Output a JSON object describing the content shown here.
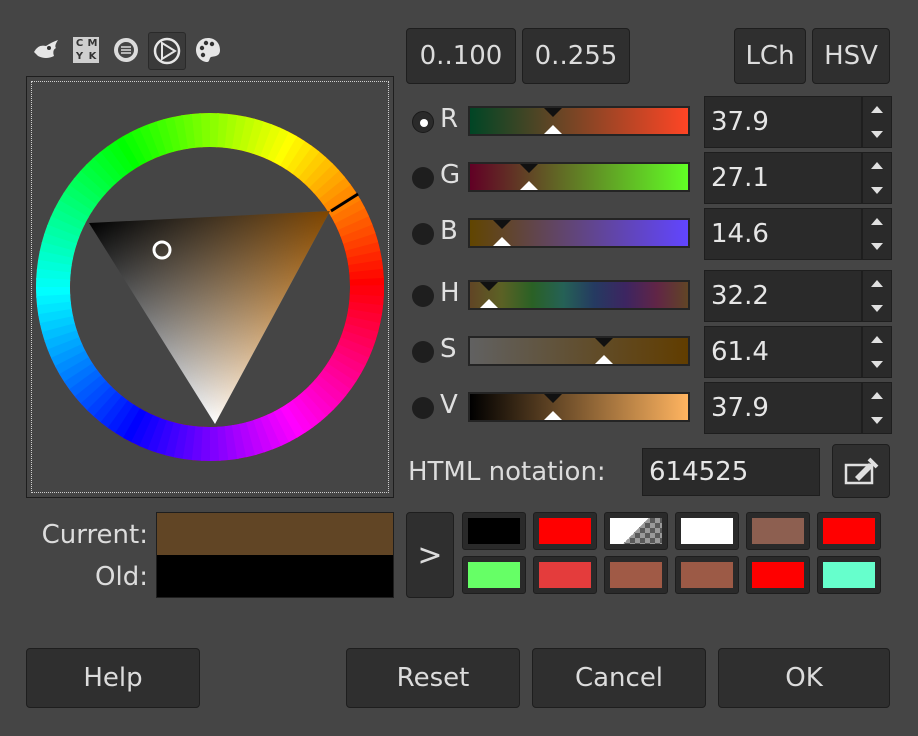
{
  "selector_tabs": [
    {
      "name": "gimp-icon"
    },
    {
      "name": "cmyk-icon",
      "label": "CMYK"
    },
    {
      "name": "watercolor-icon"
    },
    {
      "name": "triangle-wheel-icon",
      "active": true
    },
    {
      "name": "palette-icon"
    }
  ],
  "range_buttons": {
    "percent": "0..100",
    "byte": "0..255"
  },
  "model_buttons": {
    "lch": "LCh",
    "hsv": "HSV"
  },
  "channels": [
    {
      "id": "r",
      "label": "R",
      "value": "37.9",
      "selected": true,
      "level": 0.379
    },
    {
      "id": "g",
      "label": "G",
      "value": "27.1",
      "selected": false,
      "level": 0.271
    },
    {
      "id": "b",
      "label": "B",
      "value": "14.6",
      "selected": false,
      "level": 0.146
    },
    {
      "id": "h",
      "label": "H",
      "value": "32.2",
      "selected": false,
      "level": 0.089
    },
    {
      "id": "s",
      "label": "S",
      "value": "61.4",
      "selected": false,
      "level": 0.614
    },
    {
      "id": "v",
      "label": "V",
      "value": "37.9",
      "selected": false,
      "level": 0.379
    }
  ],
  "html_notation": {
    "label": "HTML notation:",
    "value": "614525"
  },
  "current_label": "Current:",
  "old_label": "Old:",
  "current_color": "#614525",
  "old_color": "#000000",
  "history_button": ">",
  "history_swatches": [
    "#000000",
    "#ff0000",
    "transparent",
    "#ffffff",
    "#8d5f50",
    "#ff0000",
    "#66ff66",
    "#e43c3c",
    "#a05a46",
    "#9c5a46",
    "#ff0000",
    "#66ffcc"
  ],
  "buttons": {
    "help": "Help",
    "reset": "Reset",
    "cancel": "Cancel",
    "ok": "OK"
  }
}
